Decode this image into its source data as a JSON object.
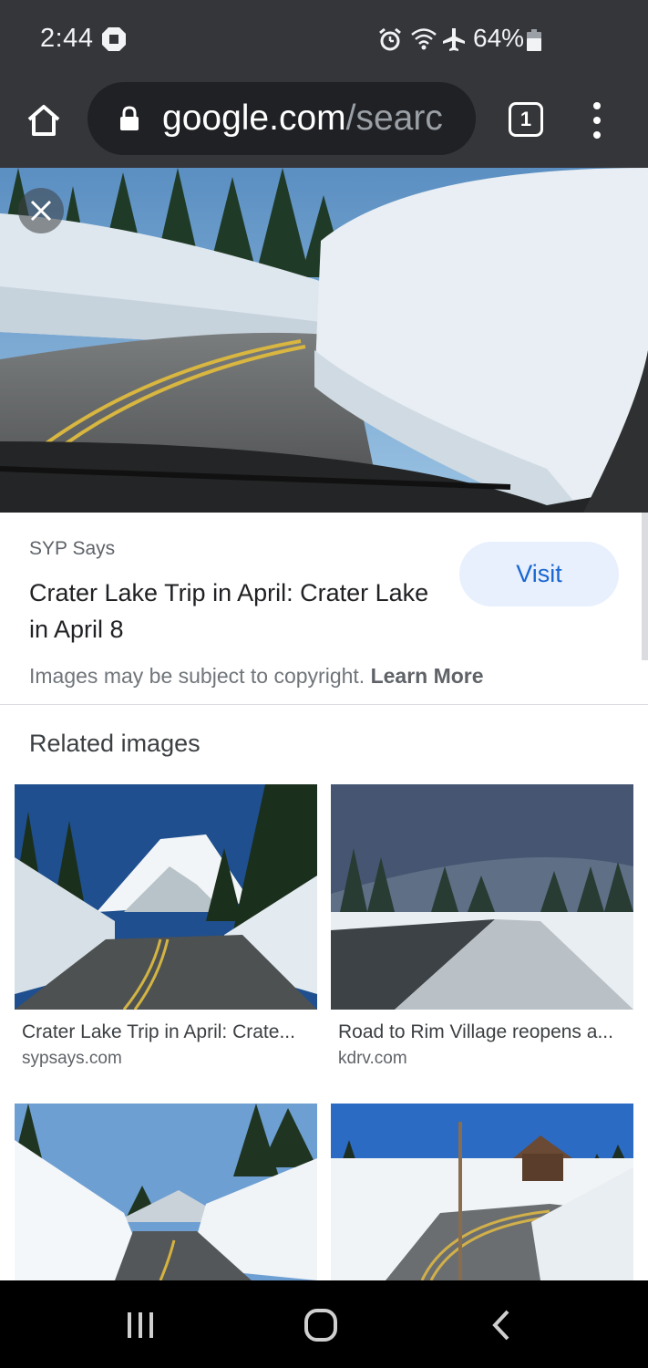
{
  "status_bar": {
    "time": "2:44",
    "battery": "64%",
    "icons": [
      "chase-icon",
      "alarm-icon",
      "wifi-icon",
      "airplane-icon",
      "battery-icon"
    ]
  },
  "browser": {
    "url_domain": "google.com",
    "url_path": "/searc",
    "tab_count": "1"
  },
  "image_viewer": {
    "source": "SYP Says",
    "title": "Crater Lake Trip in April: Crater Lake in April 8",
    "visit_label": "Visit",
    "copyright_text": "Images may be subject to copyright.",
    "learn_more": "Learn More"
  },
  "related": {
    "heading": "Related images",
    "items": [
      {
        "caption": "Crater Lake Trip in April: Crate...",
        "domain": "sypsays.com"
      },
      {
        "caption": "Road to Rim Village reopens a...",
        "domain": "kdrv.com"
      },
      {
        "caption": "",
        "domain": ""
      },
      {
        "caption": "",
        "domain": ""
      }
    ]
  },
  "colors": {
    "chrome_bar": "#35363a",
    "omnibox": "#202124",
    "visit_bg": "#e8f0fe",
    "visit_text": "#1967d2"
  }
}
